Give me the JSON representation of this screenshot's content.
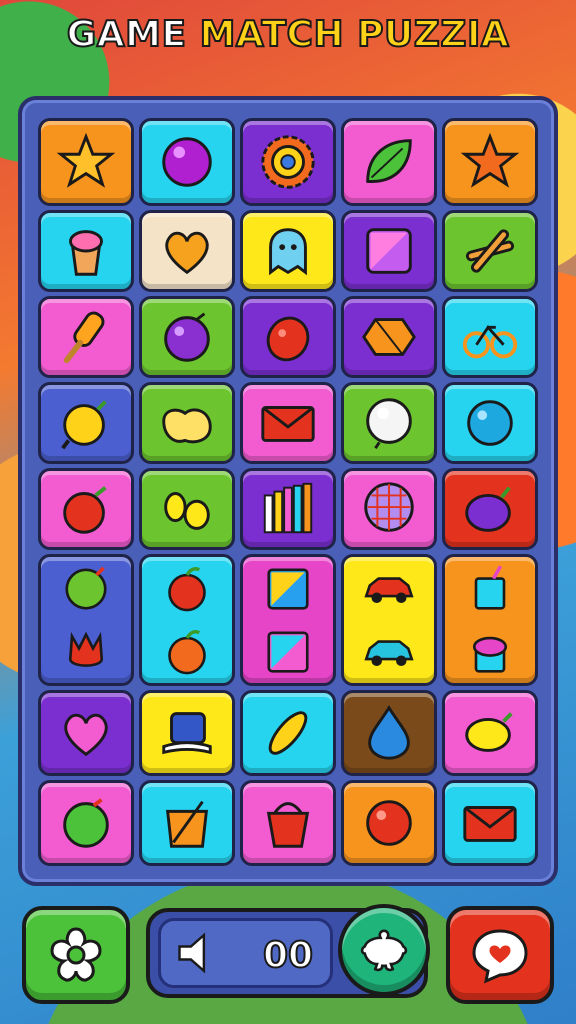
{
  "title": {
    "part1": "GAME",
    "part2": "MATCH",
    "part3": "PUZZIA"
  },
  "colors": {
    "orange": "#f7941e",
    "cyan": "#27d4f0",
    "purple": "#7b2fd0",
    "pink": "#f25cd0",
    "green": "#6cc52f",
    "yellow": "#ffe81a",
    "blue": "#4b5fd0",
    "red": "#e3331e",
    "brown": "#7a4a1a",
    "magenta": "#e645c8"
  },
  "board": {
    "rows": [
      [
        "star-icon",
        "purple-ball-icon",
        "gear-icon",
        "leaf-icon",
        "star-icon"
      ],
      [
        "ice-cream-icon",
        "heart-icon",
        "ghost-icon",
        "square-gem-icon",
        "cross-stick-icon"
      ],
      [
        "popsicle-icon",
        "plum-icon",
        "berry-icon",
        "hexagon-candy-icon",
        "bicycle-icon"
      ],
      [
        "onion-icon",
        "duck-icon",
        "envelope-icon",
        "pearl-icon",
        "blue-ball-icon"
      ],
      [
        "tomato-icon",
        "eggs-icon",
        "bar-pattern-icon",
        "balloon-icon",
        "eggplant-icon"
      ],
      [
        "lime-tulip-icon",
        "apple-pair-icon",
        "square-pair-icon",
        "car-pair-icon",
        "cup-pair-icon"
      ],
      [
        "pink-heart-icon",
        "cap-icon",
        "corn-icon",
        "water-drop-icon",
        "lemon-icon"
      ],
      [
        "green-tomato-icon",
        "shopping-bag-icon",
        "bucket-icon",
        "red-ball-icon",
        "red-envelope-icon"
      ]
    ]
  },
  "bottom_bar": {
    "left_button_icon": "flower-icon",
    "score": "00",
    "sound_icon": "speaker-icon",
    "turtle_button_icon": "turtle-icon",
    "right_button_icon": "chat-bubble-icon"
  }
}
